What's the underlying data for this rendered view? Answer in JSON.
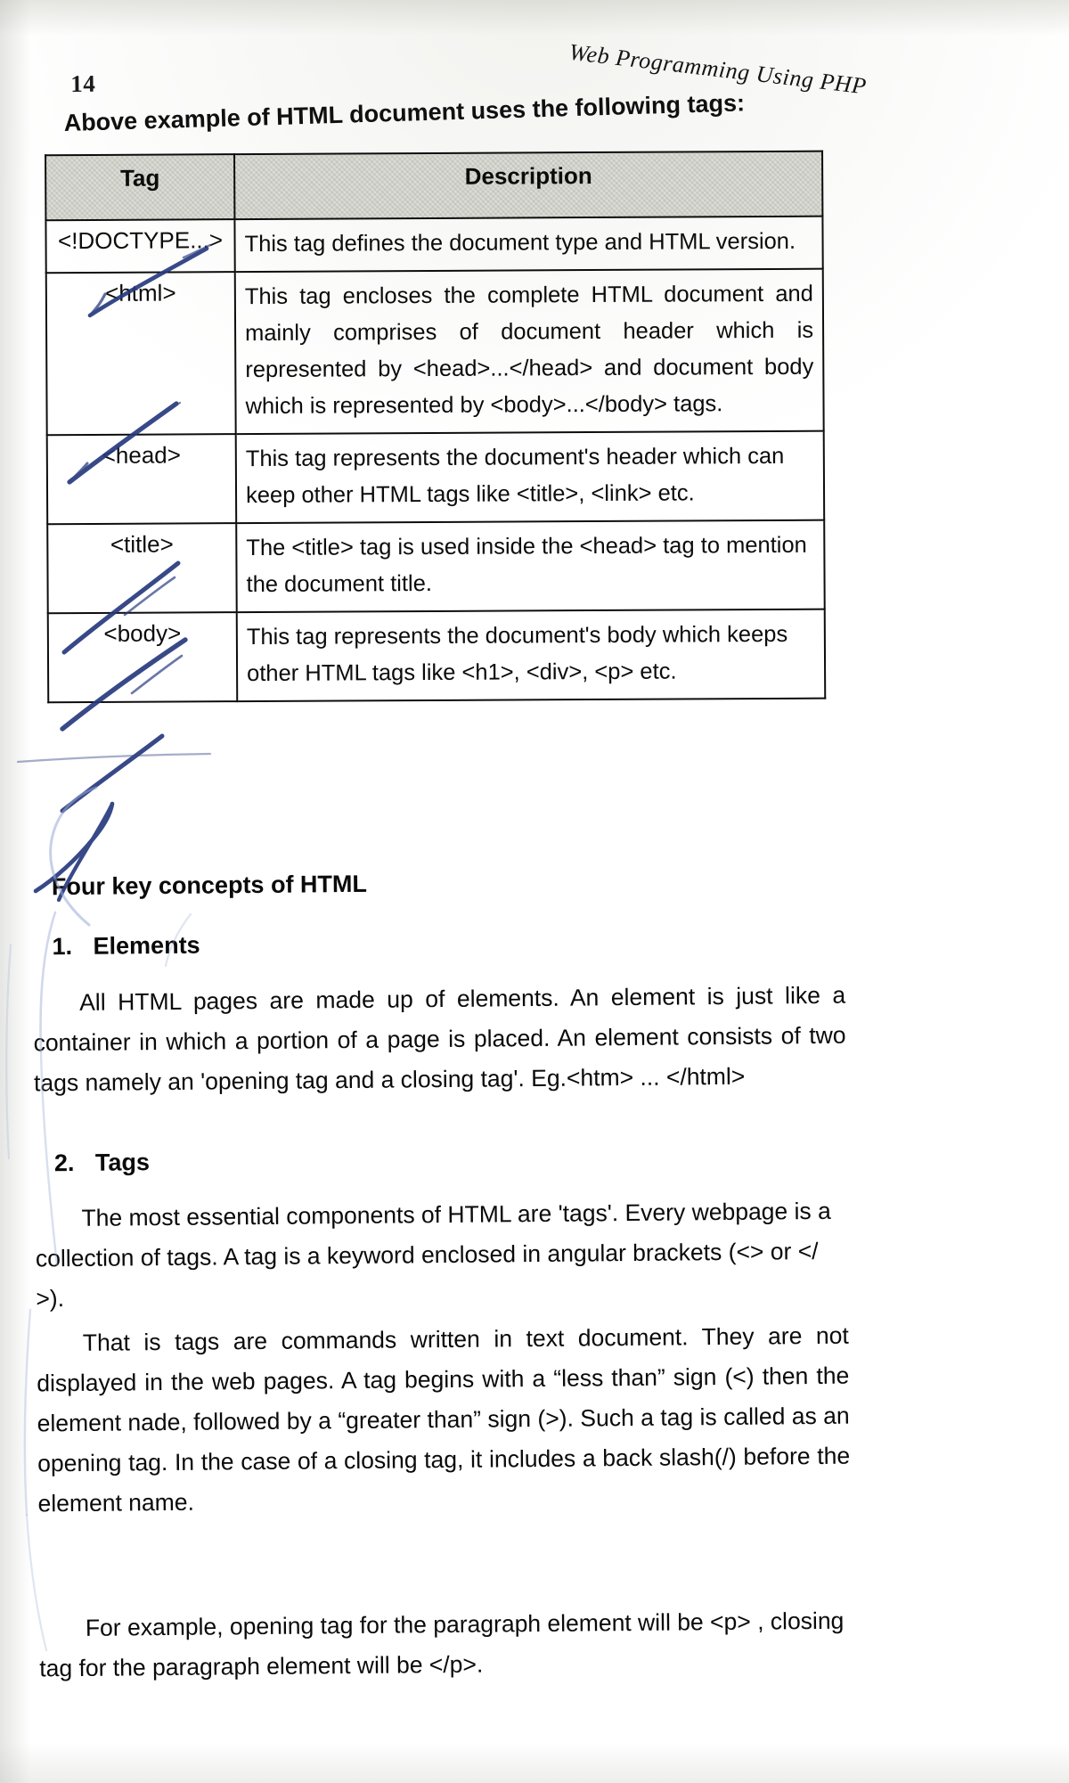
{
  "page": {
    "folio": "14",
    "running_head": "Web Programming Using PHP",
    "lead_line": "Above example of HTML document uses the following tags:"
  },
  "table": {
    "headers": [
      "Tag",
      "Description"
    ],
    "rows": [
      {
        "tag": "<!DOCTYPE...>",
        "description": "This tag defines the document type and HTML version."
      },
      {
        "tag": "<html>",
        "description": "This tag encloses the complete HTML document and mainly comprises of document header which is represented by <head>...</head> and document body which is represented by <body>...</body> tags."
      },
      {
        "tag": "<head>",
        "description": "This tag represents the document's header which can keep other HTML tags like <title>, <link> etc."
      },
      {
        "tag": "<title>",
        "description": "The <title> tag is used inside the <head> tag to mention the document title."
      },
      {
        "tag": "<body>",
        "description": "This tag represents the document's body which keeps other HTML tags like <h1>, <div>, <p> etc."
      }
    ]
  },
  "sections": {
    "heading": "Four key concepts of HTML",
    "item1": {
      "number": "1.",
      "title": "Elements"
    },
    "item1_para": "All HTML pages are made up of elements.  An element is just like a container in which a portion of a page is placed.  An element consists of two tags namely an 'opening tag and a closing tag'. Eg.<htm> ... </html>",
    "item2": {
      "number": "2.",
      "title": "Tags"
    },
    "item2_para1": "The most essential components of HTML are 'tags'.  Every webpage is a collection of tags. A tag is a keyword enclosed in angular brackets (<> or </ >).",
    "item2_para2": "That is tags are commands written in text document. They are not displayed in the web pages.  A tag begins with a “less than” sign (<) then the element nade, followed by a “greater than” sign (>).  Such a tag is called as an opening tag.  In the case of a closing tag, it includes a back slash(/) before the element name.",
    "item2_para3": "For example, opening tag for the paragraph element will be <p> , closing tag for the paragraph element will be </p>."
  },
  "annotations": {
    "ink_color": "#2b3f8c",
    "marks": "handwritten blue check marks over each tag name and the Four key concepts heading"
  }
}
